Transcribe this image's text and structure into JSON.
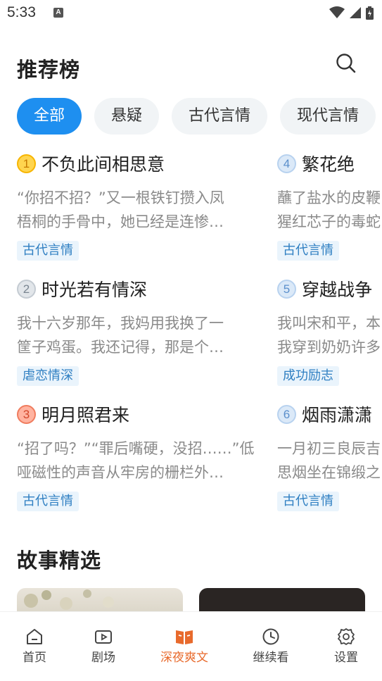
{
  "status": {
    "time": "5:33",
    "notif": "A"
  },
  "header": {
    "title": "推荐榜"
  },
  "tabs": [
    {
      "label": "全部",
      "active": true
    },
    {
      "label": "悬疑",
      "active": false
    },
    {
      "label": "古代言情",
      "active": false
    },
    {
      "label": "现代言情",
      "active": false
    }
  ],
  "rankings": [
    {
      "num": "1",
      "title": "不负此间相思意",
      "desc1": "“你招不招？”又一根铁钉攒入凤",
      "desc2": "梧桐的手骨中，她已经是连惨…",
      "tag": "古代言情"
    },
    {
      "num": "2",
      "title": "时光若有情深",
      "desc1": "我十六岁那年，我妈用我换了一",
      "desc2": "筐子鸡蛋。我还记得，那是个…",
      "tag": "虐恋情深"
    },
    {
      "num": "3",
      "title": "明月照君来",
      "desc1": "“招了吗？”“罪后嘴硬，没招……”低",
      "desc2": "哑磁性的声音从牢房的栅栏外…",
      "tag": "古代言情"
    },
    {
      "num": "4",
      "title": "繁花绝",
      "desc1": "蘸了盐水的皮鞭",
      "desc2": "猩红芯子的毒蛇",
      "tag": "古代言情"
    },
    {
      "num": "5",
      "title": "穿越战争",
      "desc1": "我叫宋和平，本",
      "desc2": "我穿到奶奶许多",
      "tag": "成功励志"
    },
    {
      "num": "6",
      "title": "烟雨潇潇",
      "desc1": "一月初三良辰吉",
      "desc2": "思烟坐在锦缎之",
      "tag": "古代言情"
    }
  ],
  "section": {
    "title": "故事精选"
  },
  "nav": [
    {
      "label": "首页",
      "icon": "home-icon",
      "active": false
    },
    {
      "label": "剧场",
      "icon": "video-icon",
      "active": false
    },
    {
      "label": "深夜爽文",
      "icon": "book-icon",
      "active": true
    },
    {
      "label": "继续看",
      "icon": "clock-icon",
      "active": false
    },
    {
      "label": "设置",
      "icon": "gear-icon",
      "active": false
    }
  ],
  "colors": {
    "accent": "#1e8ff0",
    "nav_active": "#e86a2c",
    "tag_bg": "#eaf4fc",
    "tag_text": "#2f7fc2"
  }
}
